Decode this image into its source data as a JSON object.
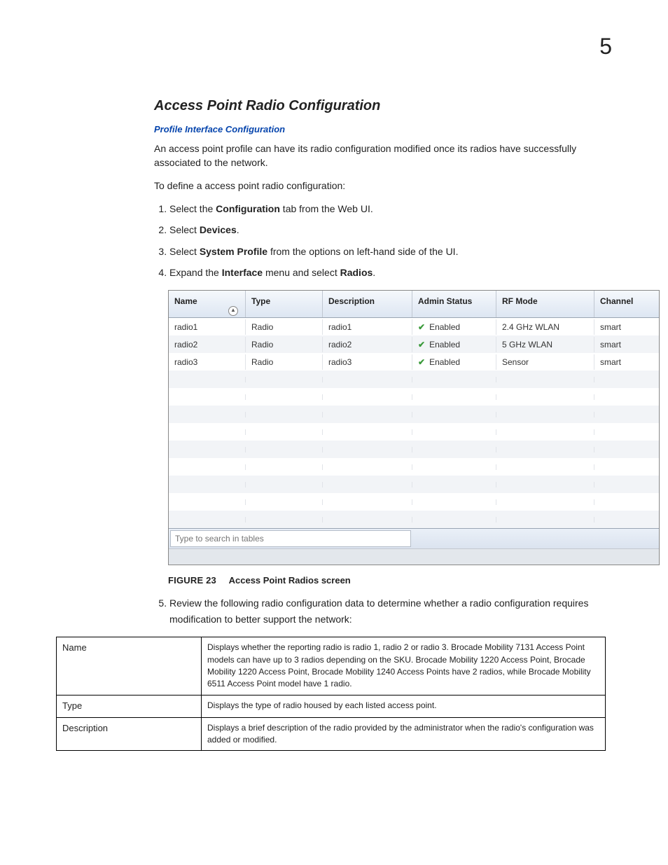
{
  "chapter": "5",
  "section_title": "Access Point Radio Configuration",
  "link_sub": "Profile Interface Configuration",
  "para1": "An access point profile can have its radio configuration modified once its radios have successfully associated to the network.",
  "para2": "To define a access point radio configuration:",
  "steps": {
    "s1a": "Select the ",
    "s1b": "Configuration",
    "s1c": " tab from the Web UI.",
    "s2a": "Select ",
    "s2b": "Devices",
    "s2c": ".",
    "s3a": "Select ",
    "s3b": "System Profile",
    "s3c": " from the options on left-hand side of the UI.",
    "s4a": "Expand the ",
    "s4b": "Interface",
    "s4c": " menu and select ",
    "s4d": "Radios",
    "s4e": "."
  },
  "headers": {
    "name": "Name",
    "type": "Type",
    "desc": "Description",
    "admin": "Admin Status",
    "rf": "RF Mode",
    "channel": "Channel"
  },
  "rows": [
    {
      "name": "radio1",
      "type": "Radio",
      "desc": "radio1",
      "status": "Enabled",
      "rf": "2.4 GHz WLAN",
      "ch": "smart"
    },
    {
      "name": "radio2",
      "type": "Radio",
      "desc": "radio2",
      "status": "Enabled",
      "rf": "5 GHz WLAN",
      "ch": "smart"
    },
    {
      "name": "radio3",
      "type": "Radio",
      "desc": "radio3",
      "status": "Enabled",
      "rf": "Sensor",
      "ch": "smart"
    }
  ],
  "empty_rows": 9,
  "search_placeholder": "Type to search in tables",
  "figure": {
    "label": "FIGURE 23",
    "text": "Access Point Radios screen"
  },
  "step5": "Review the following radio configuration data to determine whether a radio configuration requires modification to better support the network:",
  "desc_rows": [
    {
      "term": "Name",
      "text": "Displays whether the reporting radio is radio 1, radio 2 or radio 3. Brocade Mobility 7131 Access Point models can have up to 3 radios depending on the SKU. Brocade Mobility 1220 Access Point, Brocade Mobility 1220 Access Point, Brocade Mobility 1240 Access Points have 2 radios, while Brocade Mobility 6511 Access Point model have 1 radio."
    },
    {
      "term": "Type",
      "text": "Displays the type of radio housed by each listed access point."
    },
    {
      "term": "Description",
      "text": "Displays a brief description of the radio provided by the administrator when the radio's configuration was added or modified."
    }
  ]
}
